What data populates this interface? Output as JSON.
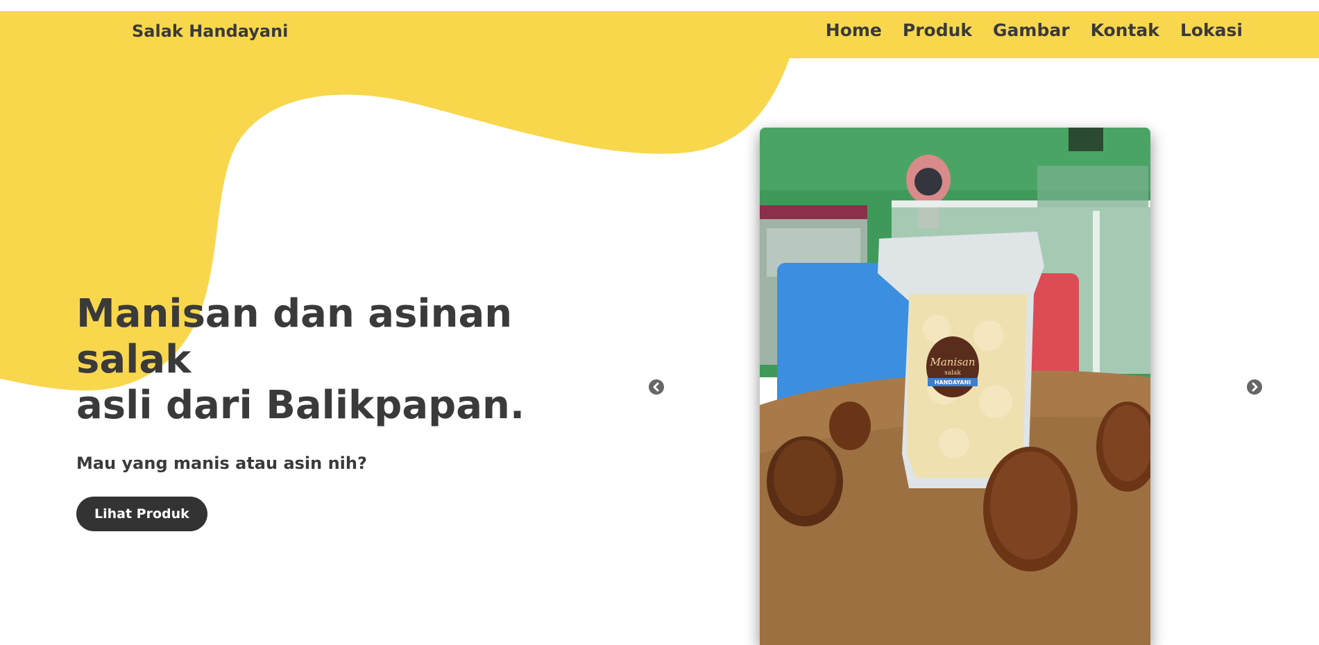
{
  "colors": {
    "accent_yellow": "#f8d74d",
    "text_dark": "#3a3a3a",
    "button_dark": "#333333"
  },
  "navbar": {
    "brand": "Salak Handayani",
    "links": [
      "Home",
      "Produk",
      "Gambar",
      "Kontak",
      "Lokasi"
    ]
  },
  "hero": {
    "title_line1": "Manisan dan asinan salak",
    "title_line2": "asli dari Balikpapan.",
    "subtitle": "Mau yang manis atau asin nih?",
    "button_label": "Lihat Produk"
  },
  "carousel": {
    "prev_icon": "chevron-left-circle-icon",
    "next_icon": "chevron-right-circle-icon",
    "product_label": {
      "line1": "Manisan",
      "line2": "salak",
      "line3": "HANDAYANI"
    }
  }
}
